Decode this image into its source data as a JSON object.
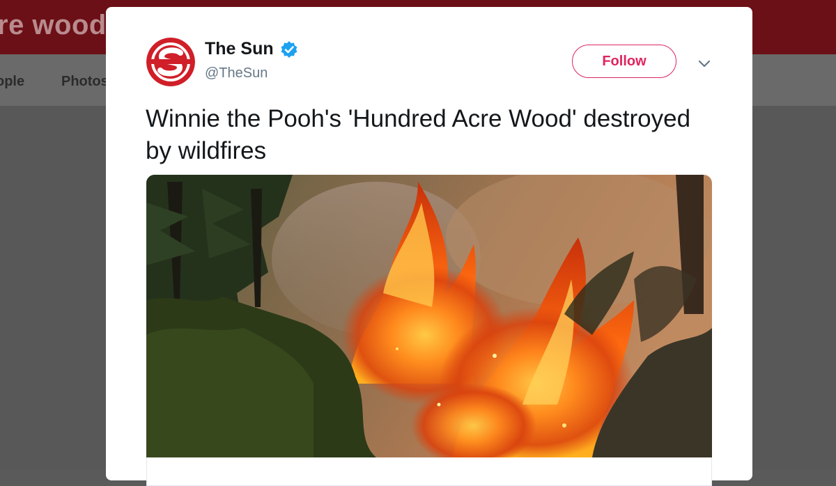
{
  "background": {
    "header_title": "re wood",
    "nav_items": [
      "ople",
      "Photos"
    ]
  },
  "tweet": {
    "account_name": "The Sun",
    "account_handle": "@TheSun",
    "verified_icon": "verified-badge-icon",
    "follow_label": "Follow",
    "more_icon": "chevron-down-icon",
    "text": "Winnie the Pooh's 'Hundred Acre Wood' destroyed by wildfires",
    "media_description": "forest-wildfire-photo"
  },
  "colors": {
    "brand_red": "#d01f28",
    "follow_accent": "#e0245e",
    "verified_blue": "#1da1f2"
  }
}
